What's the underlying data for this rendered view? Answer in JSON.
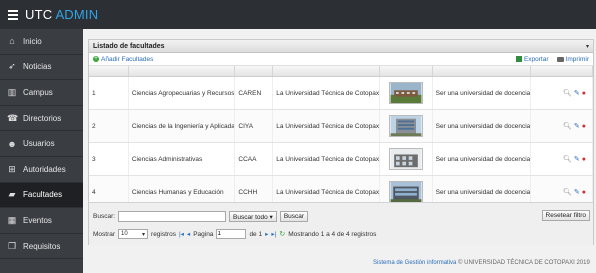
{
  "header": {
    "brand_prefix": "UTC",
    "brand_accent": "ADMIN"
  },
  "sidebar": {
    "items": [
      {
        "label": "Inicio",
        "icon": "home-icon"
      },
      {
        "label": "Noticias",
        "icon": "send-icon"
      },
      {
        "label": "Campus",
        "icon": "bank-icon"
      },
      {
        "label": "Directorios",
        "icon": "phone-icon"
      },
      {
        "label": "Usuarios",
        "icon": "user-icon"
      },
      {
        "label": "Autoridades",
        "icon": "sitemap-icon"
      },
      {
        "label": "Facultades",
        "icon": "book-icon",
        "active": true
      },
      {
        "label": "Eventos",
        "icon": "calendar-icon"
      },
      {
        "label": "Requisitos",
        "icon": "files-icon"
      }
    ]
  },
  "panel": {
    "title": "Listado de facultades",
    "add_label": "Añadir Facultades",
    "export_label": "Exportar",
    "print_label": "Imprimir"
  },
  "table": {
    "rows": [
      {
        "num": "1",
        "name": "Ciencias Agropecuarias y Recursos...",
        "sigla": "CAREN",
        "uni": "La Universidad Técnica de Cotopaxi,...",
        "mision": "Ser una universidad de docencia..."
      },
      {
        "num": "2",
        "name": "Ciencias de la Ingeniería y Aplicadas",
        "sigla": "CIYA",
        "uni": "La Universidad Técnica de Cotopaxi,...",
        "mision": "Ser una universidad de docencia..."
      },
      {
        "num": "3",
        "name": "Ciencias Administrativas",
        "sigla": "CCAA",
        "uni": "La Universidad Técnica de Cotopaxi,...",
        "mision": "Ser una universidad de docencia..."
      },
      {
        "num": "4",
        "name": "Ciencias Humanas y Educación",
        "sigla": "CCHH",
        "uni": "La Universidad Técnica de Cotopaxi,...",
        "mision": "Ser una universidad de docencia..."
      }
    ]
  },
  "footer": {
    "search_label": "Buscar:",
    "search_all": "Buscar todo ▾",
    "search_button": "Buscar",
    "reset_button": "Resetear filtro",
    "show_label": "Mostrar",
    "page_size": "10",
    "records_label": "registros",
    "page_label": "Pagina",
    "page_value": "1",
    "of_label": "de 1",
    "status": "Mostrando 1 a 4 de 4 registros"
  },
  "copyright": {
    "system": "Sistema de Gestión informativa",
    "rest": "© UNIVERSIDAD TÉCNICA DE COTOPAXI 2019"
  },
  "colors": {
    "topbar": "#2c2f33",
    "sidebar": "#3a3d42",
    "accent": "#2fa4e7",
    "link": "#2a6ebb"
  }
}
